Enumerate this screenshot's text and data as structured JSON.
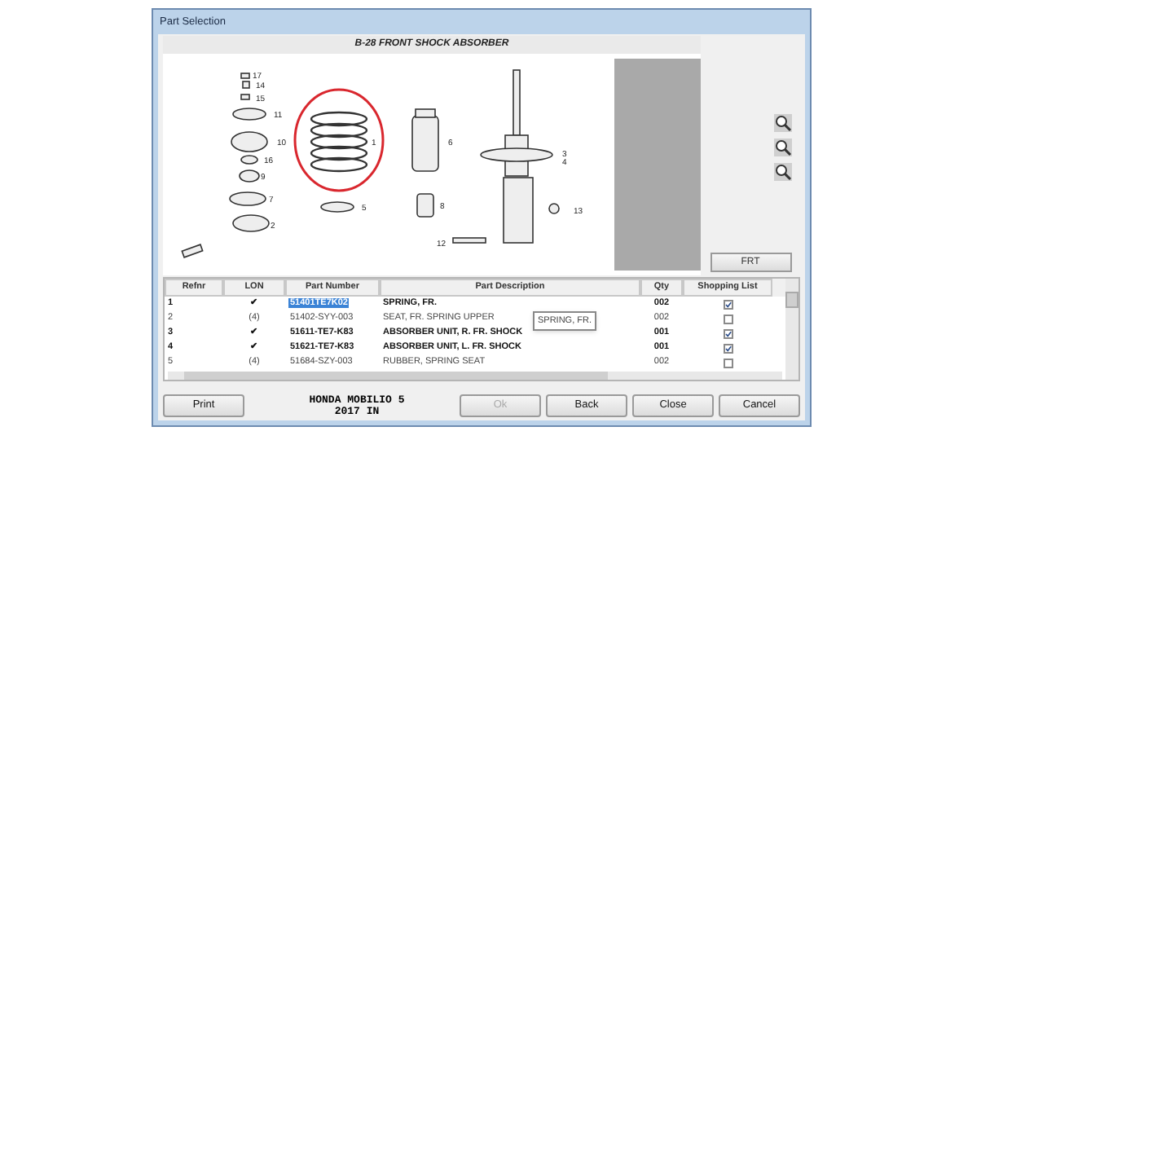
{
  "window": {
    "title": "Part Selection"
  },
  "diagram": {
    "title": "B-28 FRONT SHOCK ABSORBER",
    "callouts": [
      {
        "label": "17",
        "selected": false
      },
      {
        "label": "14",
        "selected": false
      },
      {
        "label": "15",
        "selected": false
      },
      {
        "label": "11",
        "selected": false
      },
      {
        "label": "10",
        "selected": false
      },
      {
        "label": "16",
        "selected": false
      },
      {
        "label": "9",
        "selected": false
      },
      {
        "label": "7",
        "selected": false
      },
      {
        "label": "2",
        "selected": false
      },
      {
        "label": "1",
        "selected": true
      },
      {
        "label": "5",
        "selected": false
      },
      {
        "label": "6",
        "selected": false
      },
      {
        "label": "8",
        "selected": false
      },
      {
        "label": "3",
        "selected": false
      },
      {
        "label": "4",
        "selected": false
      },
      {
        "label": "13",
        "selected": false
      },
      {
        "label": "12",
        "selected": false
      }
    ]
  },
  "view_button": "FRT",
  "table": {
    "columns": [
      "Refnr",
      "LON",
      "Part Number",
      "Part Description",
      "Qty",
      "Shopping List"
    ],
    "rows": [
      {
        "refnr": "1",
        "lon": "✔",
        "part_number": "51401TE7K02",
        "description": "SPRING, FR.",
        "qty": "002",
        "in_list": true,
        "bold": true,
        "selected": true
      },
      {
        "refnr": "2",
        "lon": "(4)",
        "part_number": "51402-SYY-003",
        "description": "SEAT, FR. SPRING UPPER",
        "qty": "002",
        "in_list": false,
        "bold": false,
        "selected": false
      },
      {
        "refnr": "3",
        "lon": "✔",
        "part_number": "51611-TE7-K83",
        "description": "ABSORBER UNIT, R. FR. SHOCK",
        "qty": "001",
        "in_list": true,
        "bold": true,
        "selected": false
      },
      {
        "refnr": "4",
        "lon": "✔",
        "part_number": "51621-TE7-K83",
        "description": "ABSORBER UNIT, L. FR. SHOCK",
        "qty": "001",
        "in_list": true,
        "bold": true,
        "selected": false
      },
      {
        "refnr": "5",
        "lon": "(4)",
        "part_number": "51684-SZY-003",
        "description": "RUBBER, SPRING SEAT",
        "qty": "002",
        "in_list": false,
        "bold": false,
        "selected": false
      }
    ],
    "tooltip": "SPRING, FR."
  },
  "vehicle": [
    "HONDA MOBILIO 5",
    "2017 IN"
  ],
  "buttons": [
    {
      "label": "Print",
      "disabled": false
    },
    {
      "label": "Ok",
      "disabled": true
    },
    {
      "label": "Back",
      "disabled": false
    },
    {
      "label": "Close",
      "disabled": false
    },
    {
      "label": "Cancel",
      "disabled": false
    }
  ]
}
